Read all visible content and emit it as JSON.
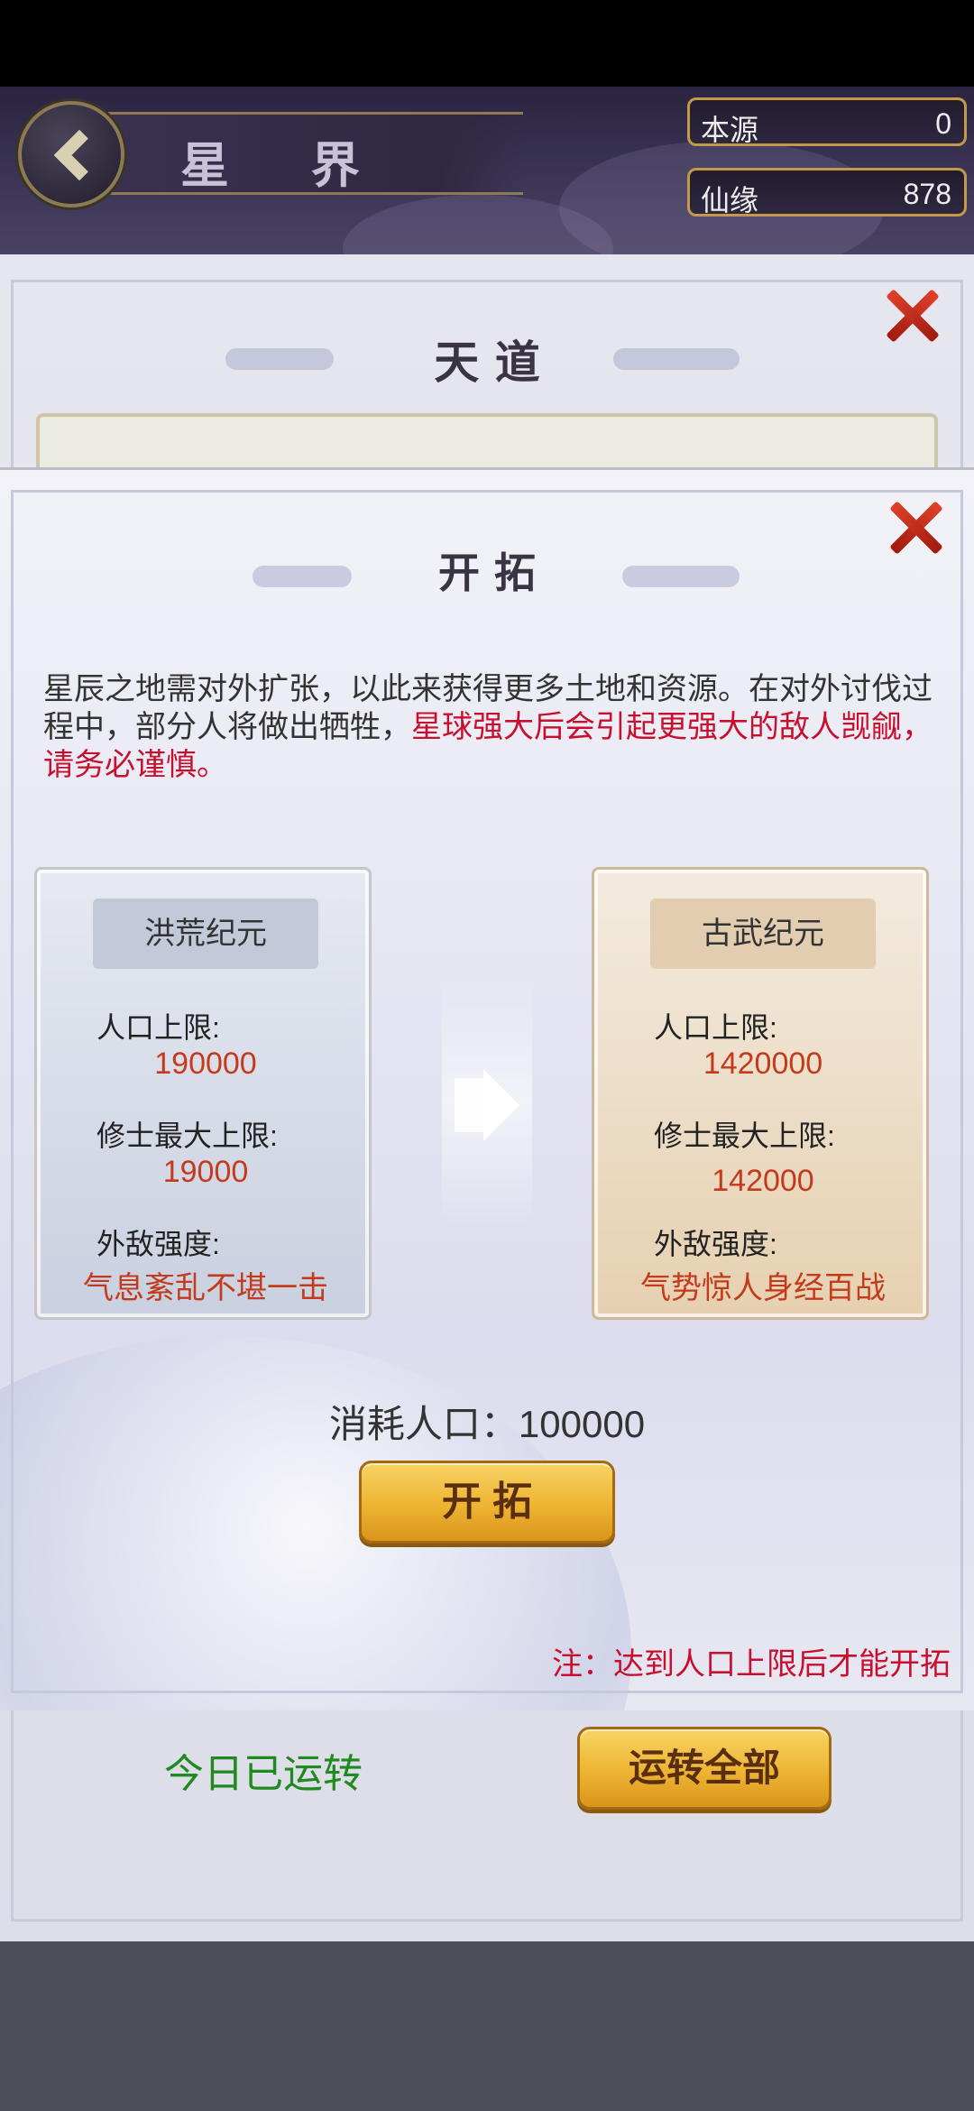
{
  "header": {
    "title": "星 界",
    "resources": [
      {
        "label": "本源",
        "value": "0"
      },
      {
        "label": "仙缘",
        "value": "878"
      }
    ]
  },
  "background_panel": {
    "title": "天 道",
    "today_status": "今日已运转",
    "run_all_button": "运转全部"
  },
  "dialog": {
    "title": "开 拓",
    "intro_normal": "星辰之地需对外扩张，以此来获得更多土地和资源。在对外讨伐过程中，部分人将做出牺牲，",
    "intro_warning": "星球强大后会引起更强大的敌人觊觎，请务必谨慎。",
    "current_era": {
      "name": "洪荒纪元",
      "population_label": "人口上限:",
      "population_value": "190000",
      "cultivator_label": "修士最大上限:",
      "cultivator_value": "19000",
      "enemy_label": "外敌强度:",
      "enemy_value": "气息紊乱不堪一击"
    },
    "next_era": {
      "name": "古武纪元",
      "population_label": "人口上限:",
      "population_value": "1420000",
      "cultivator_label": "修士最大上限:",
      "cultivator_value": "142000",
      "enemy_label": "外敌强度:",
      "enemy_value": "气势惊人身经百战"
    },
    "consume_text": "消耗人口：100000",
    "expand_button": "开 拓",
    "note": "注：达到人口上限后才能开拓"
  },
  "colors": {
    "warning_red": "#c8102e",
    "value_red": "#c33b1c",
    "status_green": "#1f8a1f",
    "gold_button": "#eeb432"
  }
}
